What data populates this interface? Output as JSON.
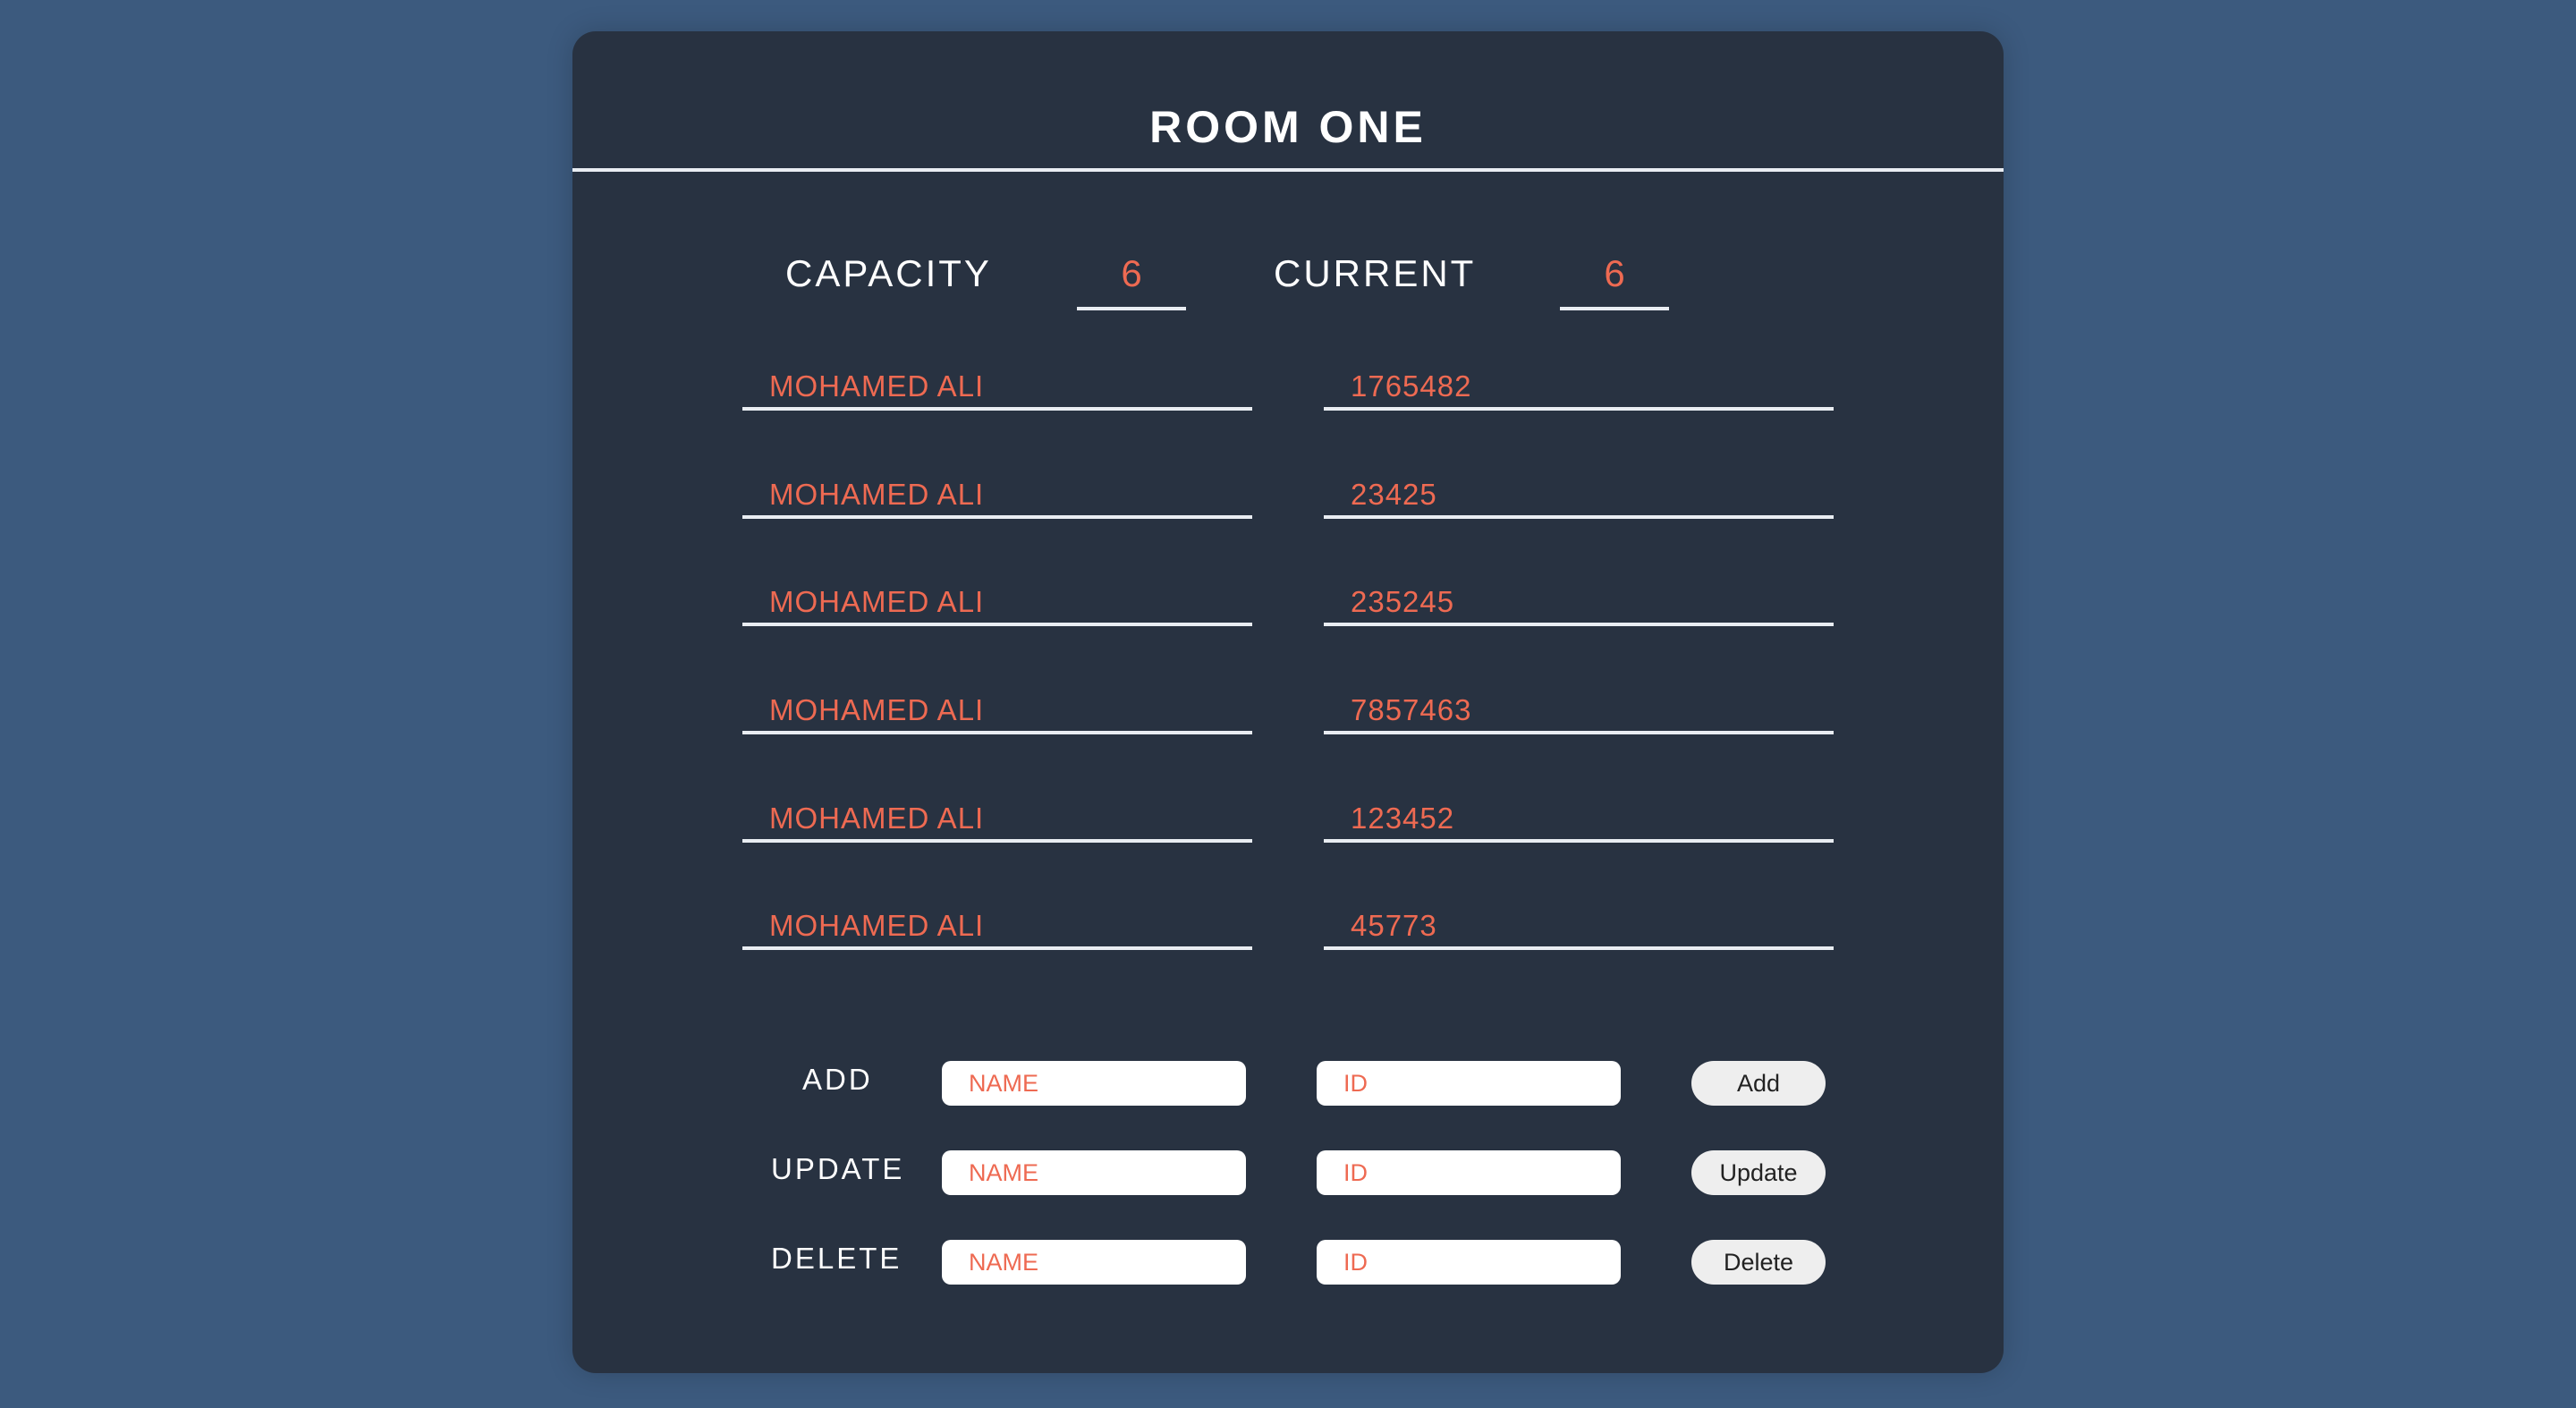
{
  "room": {
    "title": "ROOM ONE"
  },
  "stats": {
    "capacity_label": "CAPACITY",
    "capacity_value": "6",
    "current_label": "CURRENT",
    "current_value": "6"
  },
  "residents": [
    {
      "name": "MOHAMED ALI",
      "id": "1765482"
    },
    {
      "name": "MOHAMED ALI",
      "id": "23425"
    },
    {
      "name": "MOHAMED ALI",
      "id": "235245"
    },
    {
      "name": "MOHAMED ALI",
      "id": "7857463"
    },
    {
      "name": "MOHAMED ALI",
      "id": "123452"
    },
    {
      "name": "MOHAMED ALI",
      "id": "45773"
    }
  ],
  "actions": {
    "add": {
      "label": "ADD",
      "name_placeholder": "NAME",
      "id_placeholder": "ID",
      "button": "Add"
    },
    "update": {
      "label": "UPDATE",
      "name_placeholder": "NAME",
      "id_placeholder": "ID",
      "button": "Update"
    },
    "delete": {
      "label": "DELETE",
      "name_placeholder": "NAME",
      "id_placeholder": "ID",
      "button": "Delete"
    }
  },
  "colors": {
    "page_background": "#3c5a7e",
    "card_background": "#283241",
    "accent": "#ee6a52",
    "text": "#ffffff"
  }
}
